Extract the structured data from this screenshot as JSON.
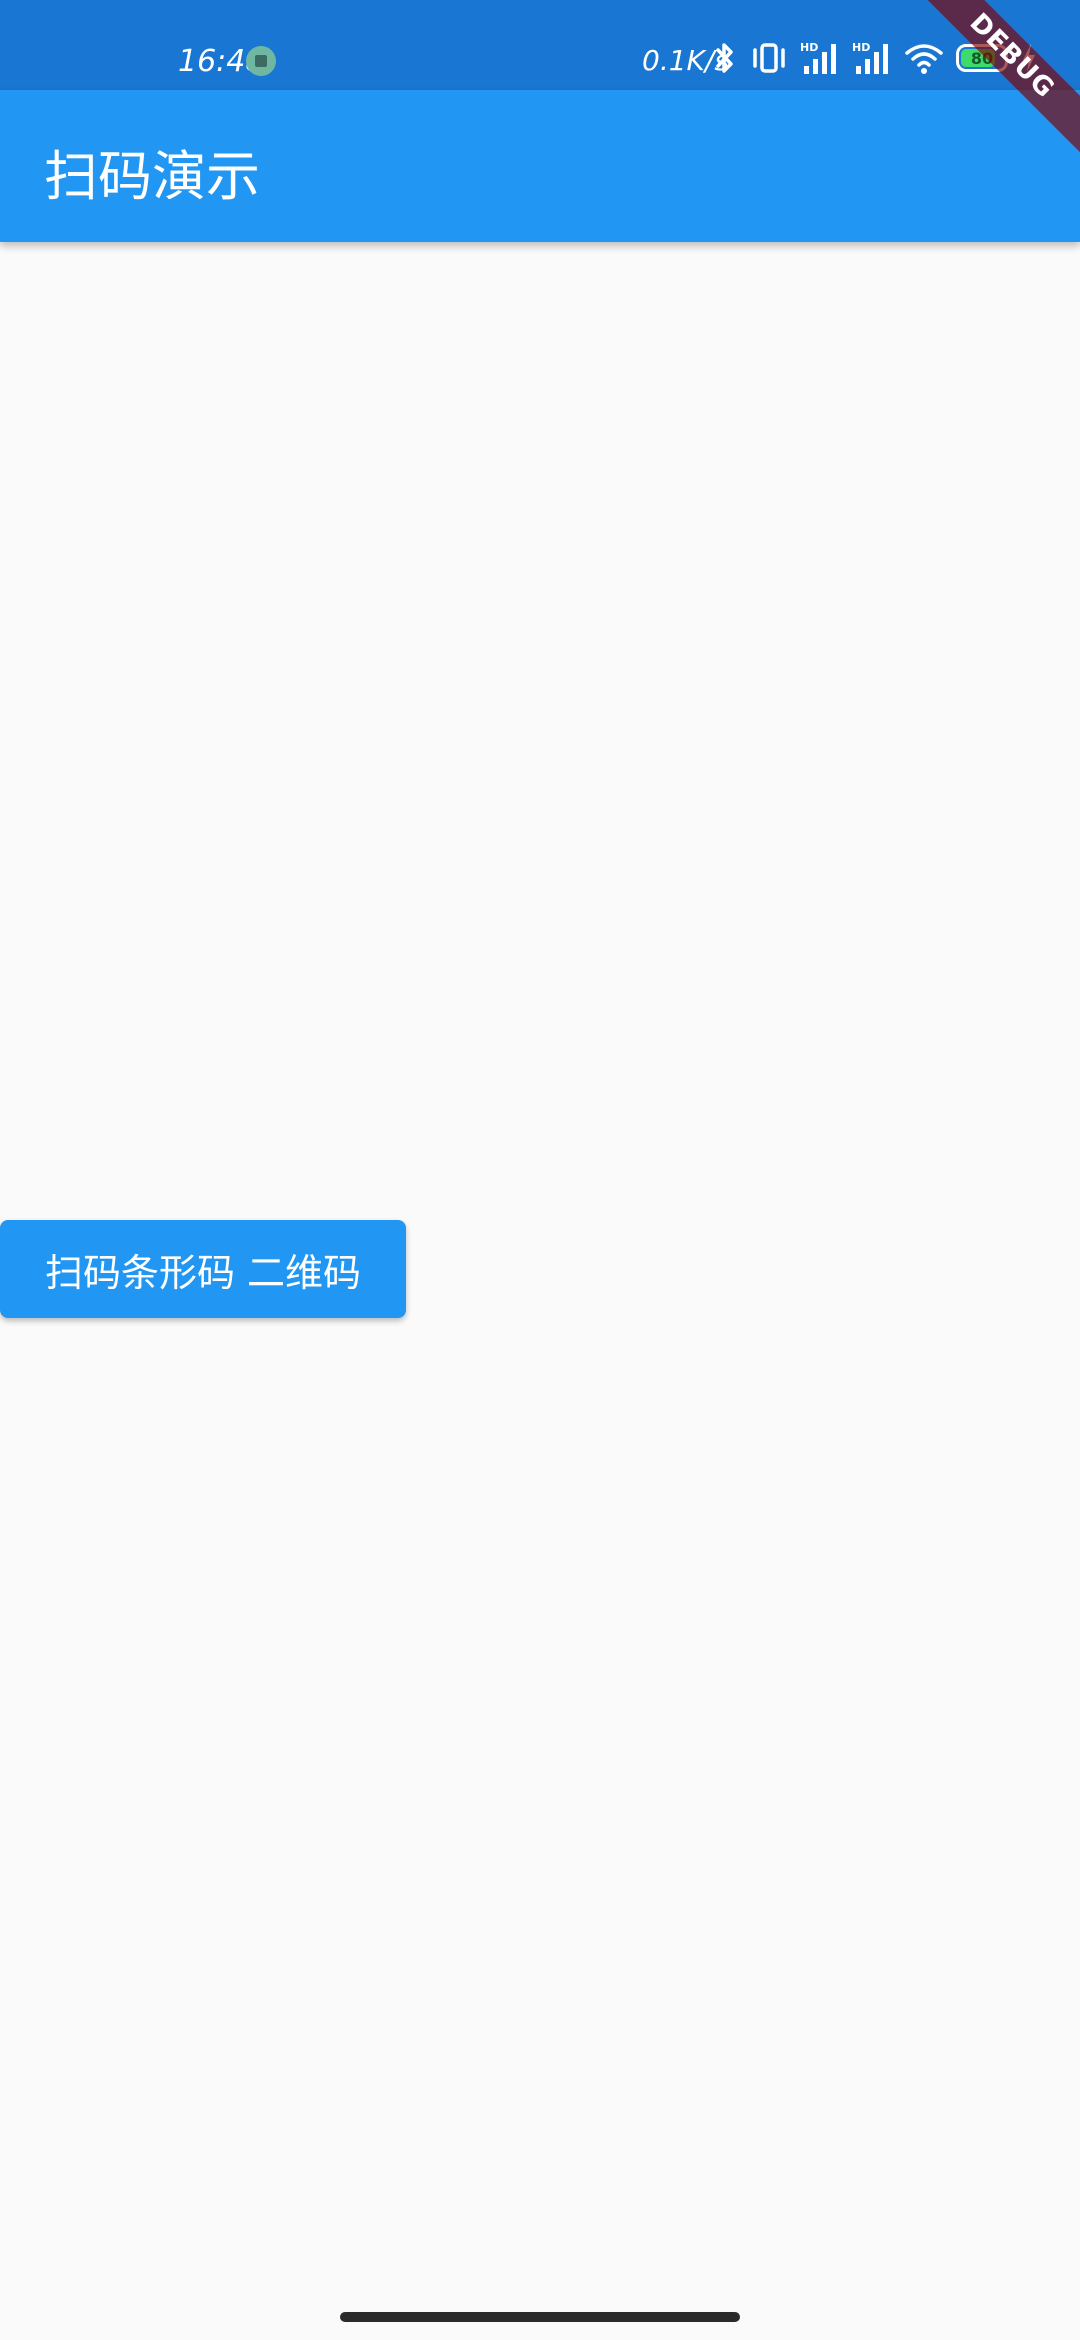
{
  "status_bar": {
    "time": "16:48",
    "net_speed": "0.1K/s",
    "battery_level": "80",
    "icons": [
      "app-notification-icon",
      "bluetooth-icon",
      "vibrate-icon",
      "hd-signal-icon",
      "hd-signal-icon",
      "wifi-icon",
      "battery-icon",
      "charging-icon"
    ],
    "background": "#1976D2"
  },
  "app_bar": {
    "title": "扫码演示",
    "color": "#2196F3"
  },
  "debug_banner": {
    "label": "DEBUG"
  },
  "main": {
    "scan_button_label": "扫码条形码 二维码"
  }
}
